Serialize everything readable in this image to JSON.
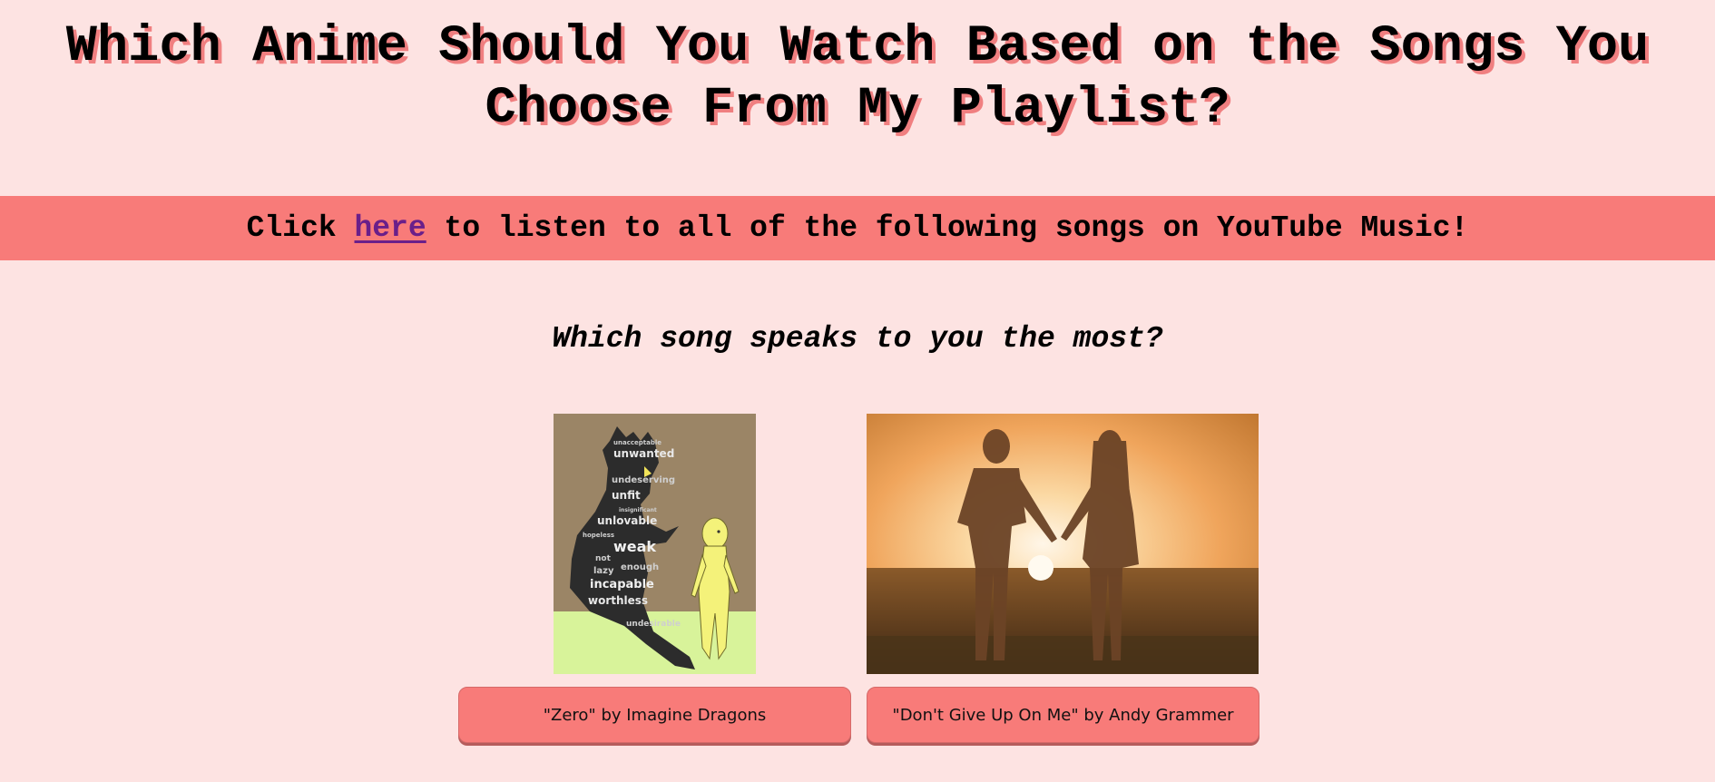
{
  "page": {
    "title": "Which Anime Should You Watch Based on the Songs You Choose From My Playlist?",
    "banner": {
      "prefix": "Click ",
      "link_text": "here",
      "suffix": " to listen to all of the following songs on YouTube Music!"
    },
    "question": "Which song speaks to you the most?"
  },
  "choices": [
    {
      "label": "\"Zero\" by Imagine Dragons",
      "image": "zero-illustration",
      "shadow_words": [
        "unacceptable",
        "unwanted",
        "undeserving",
        "unfit",
        "unlovable",
        "insignificant",
        "weak",
        "not",
        "enough",
        "lazy",
        "incapable",
        "worthless",
        "undesirable",
        "hopeless"
      ]
    },
    {
      "label": "\"Don't Give Up On Me\" by Andy Grammer",
      "image": "couple-sunset-photo"
    }
  ],
  "colors": {
    "background": "#fde3e2",
    "accent": "#f87b79",
    "title_shadow": "#f07f80",
    "link": "#6a1f8a"
  }
}
